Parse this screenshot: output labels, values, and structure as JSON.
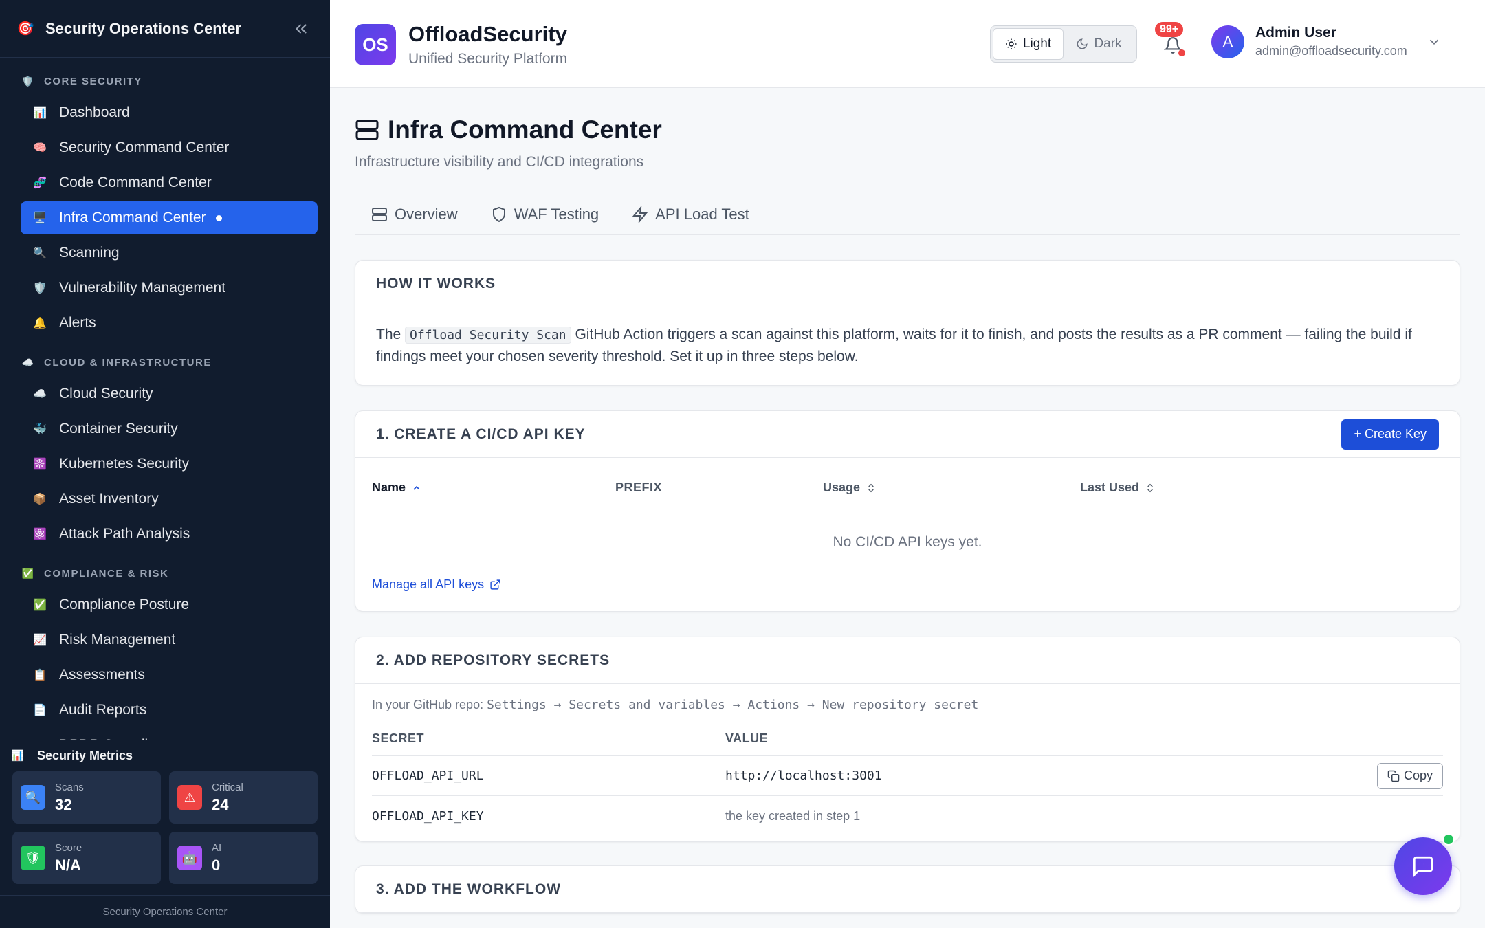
{
  "sidebar": {
    "title": "Security Operations Center",
    "sections": [
      {
        "label": "CORE SECURITY",
        "icon": "🛡️",
        "items": [
          {
            "label": "Dashboard",
            "icon": "📊"
          },
          {
            "label": "Security Command Center",
            "icon": "🧠"
          },
          {
            "label": "Code Command Center",
            "icon": "🧬"
          },
          {
            "label": "Infra Command Center",
            "icon": "🖥️",
            "active": true
          },
          {
            "label": "Scanning",
            "icon": "🔍"
          },
          {
            "label": "Vulnerability Management",
            "icon": "🛡️"
          },
          {
            "label": "Alerts",
            "icon": "🔔"
          }
        ]
      },
      {
        "label": "CLOUD & INFRASTRUCTURE",
        "icon": "☁️",
        "items": [
          {
            "label": "Cloud Security",
            "icon": "☁️"
          },
          {
            "label": "Container Security",
            "icon": "🐳"
          },
          {
            "label": "Kubernetes Security",
            "icon": "☸️"
          },
          {
            "label": "Asset Inventory",
            "icon": "📦"
          },
          {
            "label": "Attack Path Analysis",
            "icon": "⚛️"
          }
        ]
      },
      {
        "label": "COMPLIANCE & RISK",
        "icon": "✅",
        "items": [
          {
            "label": "Compliance Posture",
            "icon": "✅"
          },
          {
            "label": "Risk Management",
            "icon": "📈"
          },
          {
            "label": "Assessments",
            "icon": "📋"
          },
          {
            "label": "Audit Reports",
            "icon": "📄"
          },
          {
            "label": "DPDP Compliance",
            "icon": "🇮🇳"
          }
        ]
      }
    ],
    "metrics": {
      "title": "Security Metrics",
      "cards": [
        {
          "label": "Scans",
          "value": "32",
          "icon": "🔍",
          "color": "#3b82f6"
        },
        {
          "label": "Critical",
          "value": "24",
          "icon": "⚠",
          "color": "#ef4444"
        },
        {
          "label": "Score",
          "value": "N/A",
          "icon": "🛡",
          "color": "#22c55e"
        },
        {
          "label": "AI",
          "value": "0",
          "icon": "🤖",
          "color": "#a855f7"
        }
      ]
    },
    "footer": "Security Operations Center"
  },
  "header": {
    "badge": "OS",
    "brand": "OffloadSecurity",
    "subtitle": "Unified Security Platform",
    "theme": {
      "light": "Light",
      "dark": "Dark",
      "selected": "Light"
    },
    "notifications": "99+",
    "user": {
      "initial": "A",
      "name": "Admin User",
      "email": "admin@offloadsecurity.com"
    }
  },
  "page": {
    "title": "Infra Command Center",
    "subtitle": "Infrastructure visibility and CI/CD integrations",
    "tabs": [
      {
        "label": "Overview",
        "icon": "server-icon"
      },
      {
        "label": "WAF Testing",
        "icon": "shield-icon"
      },
      {
        "label": "API Load Test",
        "icon": "bolt-icon"
      }
    ]
  },
  "how": {
    "title": "HOW IT WORKS",
    "pre": "The ",
    "code": "Offload Security Scan",
    "post": " GitHub Action triggers a scan against this platform, waits for it to finish, and posts the results as a PR comment — failing the build if findings meet your chosen severity threshold. Set it up in three steps below."
  },
  "step1": {
    "title": "1. CREATE A CI/CD API KEY",
    "button": "+ Create Key",
    "columns": [
      "Name",
      "PREFIX",
      "Usage",
      "Last Used"
    ],
    "empty": "No CI/CD API keys yet.",
    "link": "Manage all API keys"
  },
  "step2": {
    "title": "2. ADD REPOSITORY SECRETS",
    "help_pre": "In your GitHub repo: ",
    "help_path": "Settings → Secrets and variables → Actions → New repository secret",
    "columns": [
      "SECRET",
      "VALUE"
    ],
    "rows": [
      {
        "secret": "OFFLOAD_API_URL",
        "value": "http://localhost:3001",
        "action": "Copy"
      },
      {
        "secret": "OFFLOAD_API_KEY",
        "value": "the key created in step 1"
      }
    ]
  },
  "step3": {
    "title": "3. ADD THE WORKFLOW"
  }
}
